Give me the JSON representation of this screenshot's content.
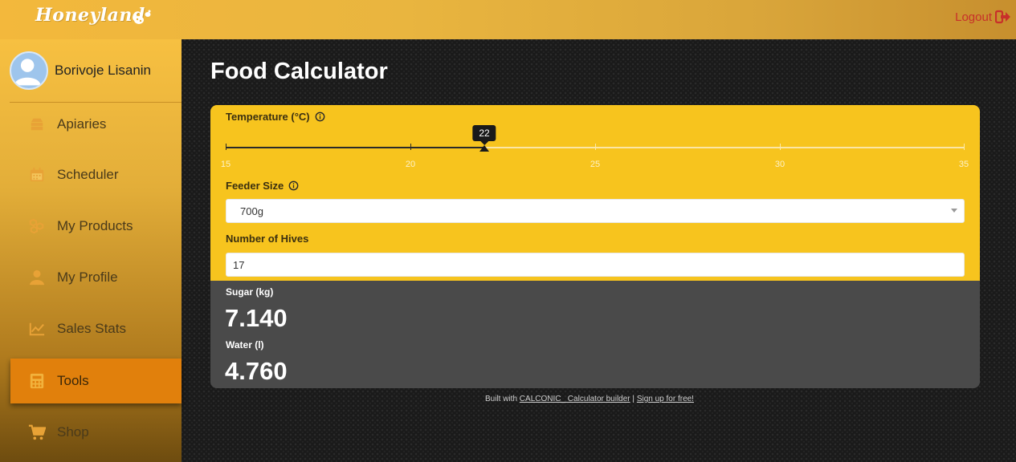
{
  "header": {
    "logo_text": "Honeyland",
    "logout_label": "Logout"
  },
  "sidebar": {
    "user_name": "Borivoje Lisanin",
    "items": [
      {
        "label": "Apiaries",
        "icon": "beehive-icon"
      },
      {
        "label": "Scheduler",
        "icon": "calendar-icon"
      },
      {
        "label": "My Products",
        "icon": "honeycomb-icon"
      },
      {
        "label": "My Profile",
        "icon": "user-icon"
      },
      {
        "label": "Sales Stats",
        "icon": "chart-line-icon"
      },
      {
        "label": "Tools",
        "icon": "calculator-icon",
        "active": true
      },
      {
        "label": "Shop",
        "icon": "shopping-cart-icon"
      }
    ]
  },
  "main": {
    "title": "Food Calculator",
    "temperature": {
      "label": "Temperature (°C)",
      "value": "22",
      "min": 15,
      "max": 35,
      "ticks": [
        "15",
        "20",
        "25",
        "30",
        "35"
      ]
    },
    "feeder_size": {
      "label": "Feeder Size",
      "value": "700g"
    },
    "hives": {
      "label": "Number of Hives",
      "value": "17"
    },
    "sugar": {
      "label": "Sugar (kg)",
      "value": "7.140"
    },
    "water": {
      "label": "Water (l)",
      "value": "4.760"
    }
  },
  "footer": {
    "prefix": "Built with",
    "link1": "CALCONIC_ Calculator builder",
    "separator": "|",
    "link2": "Sign up for free!"
  },
  "colors": {
    "accent": "#f7c41e",
    "active_nav": "#e1800c",
    "output_bg": "#4a4a4a",
    "logout": "#c8302a"
  }
}
